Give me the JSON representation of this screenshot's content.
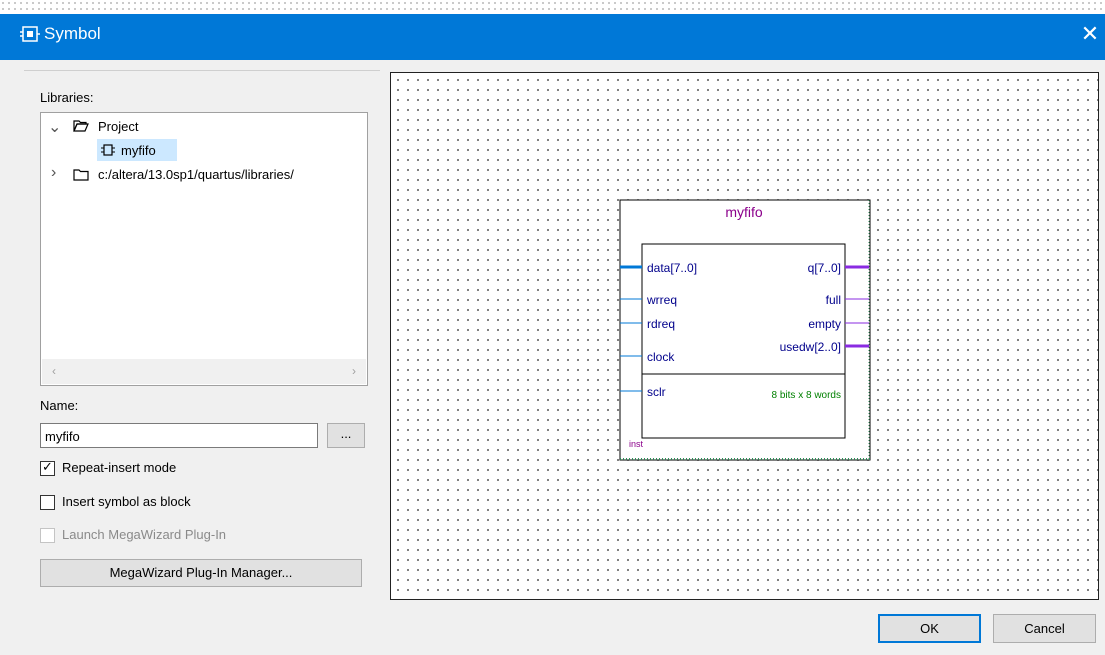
{
  "window": {
    "title": "Symbol",
    "close_glyph": "✕"
  },
  "left": {
    "libraries_label": "Libraries:",
    "tree": [
      {
        "label": "Project",
        "icon": "folder-open-icon",
        "chevron": "⌄"
      },
      {
        "label": "myfifo",
        "icon": "symbol-icon",
        "selected": true
      },
      {
        "label": "c:/altera/13.0sp1/quartus/libraries/",
        "icon": "folder-icon",
        "chevron": "›"
      }
    ],
    "name_label": "Name:",
    "name_value": "myfifo",
    "browse_label": "...",
    "options": {
      "repeat_insert": {
        "label": "Repeat-insert mode",
        "checked": true
      },
      "insert_block": {
        "label": "Insert symbol as block",
        "checked": false
      },
      "launch_mega": {
        "label": "Launch MegaWizard Plug-In",
        "checked": false,
        "disabled": true
      }
    },
    "megawizard_button": "MegaWizard Plug-In Manager..."
  },
  "symbol": {
    "name": "myfifo",
    "inputs": [
      "data[7..0]",
      "wrreq",
      "rdreq",
      "clock",
      "sclr"
    ],
    "outputs": [
      "q[7..0]",
      "full",
      "empty",
      "usedw[2..0]"
    ],
    "info": "8 bits x 8 words",
    "instance": "inst"
  },
  "buttons": {
    "ok": "OK",
    "cancel": "Cancel"
  },
  "colors": {
    "accent": "#0078d7",
    "title_purple": "#8b008b",
    "in_pin": "#0078d7",
    "out_pin": "#8a2be2",
    "info_green": "#008000"
  }
}
